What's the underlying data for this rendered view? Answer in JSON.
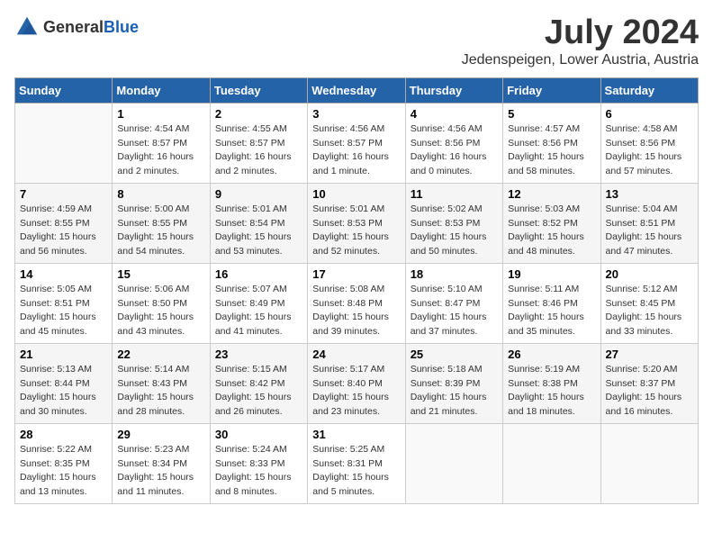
{
  "header": {
    "logo_general": "General",
    "logo_blue": "Blue",
    "month": "July 2024",
    "location": "Jedenspeigen, Lower Austria, Austria"
  },
  "weekdays": [
    "Sunday",
    "Monday",
    "Tuesday",
    "Wednesday",
    "Thursday",
    "Friday",
    "Saturday"
  ],
  "weeks": [
    [
      {
        "day": "",
        "info": ""
      },
      {
        "day": "1",
        "info": "Sunrise: 4:54 AM\nSunset: 8:57 PM\nDaylight: 16 hours\nand 2 minutes."
      },
      {
        "day": "2",
        "info": "Sunrise: 4:55 AM\nSunset: 8:57 PM\nDaylight: 16 hours\nand 2 minutes."
      },
      {
        "day": "3",
        "info": "Sunrise: 4:56 AM\nSunset: 8:57 PM\nDaylight: 16 hours\nand 1 minute."
      },
      {
        "day": "4",
        "info": "Sunrise: 4:56 AM\nSunset: 8:56 PM\nDaylight: 16 hours\nand 0 minutes."
      },
      {
        "day": "5",
        "info": "Sunrise: 4:57 AM\nSunset: 8:56 PM\nDaylight: 15 hours\nand 58 minutes."
      },
      {
        "day": "6",
        "info": "Sunrise: 4:58 AM\nSunset: 8:56 PM\nDaylight: 15 hours\nand 57 minutes."
      }
    ],
    [
      {
        "day": "7",
        "info": "Sunrise: 4:59 AM\nSunset: 8:55 PM\nDaylight: 15 hours\nand 56 minutes."
      },
      {
        "day": "8",
        "info": "Sunrise: 5:00 AM\nSunset: 8:55 PM\nDaylight: 15 hours\nand 54 minutes."
      },
      {
        "day": "9",
        "info": "Sunrise: 5:01 AM\nSunset: 8:54 PM\nDaylight: 15 hours\nand 53 minutes."
      },
      {
        "day": "10",
        "info": "Sunrise: 5:01 AM\nSunset: 8:53 PM\nDaylight: 15 hours\nand 52 minutes."
      },
      {
        "day": "11",
        "info": "Sunrise: 5:02 AM\nSunset: 8:53 PM\nDaylight: 15 hours\nand 50 minutes."
      },
      {
        "day": "12",
        "info": "Sunrise: 5:03 AM\nSunset: 8:52 PM\nDaylight: 15 hours\nand 48 minutes."
      },
      {
        "day": "13",
        "info": "Sunrise: 5:04 AM\nSunset: 8:51 PM\nDaylight: 15 hours\nand 47 minutes."
      }
    ],
    [
      {
        "day": "14",
        "info": "Sunrise: 5:05 AM\nSunset: 8:51 PM\nDaylight: 15 hours\nand 45 minutes."
      },
      {
        "day": "15",
        "info": "Sunrise: 5:06 AM\nSunset: 8:50 PM\nDaylight: 15 hours\nand 43 minutes."
      },
      {
        "day": "16",
        "info": "Sunrise: 5:07 AM\nSunset: 8:49 PM\nDaylight: 15 hours\nand 41 minutes."
      },
      {
        "day": "17",
        "info": "Sunrise: 5:08 AM\nSunset: 8:48 PM\nDaylight: 15 hours\nand 39 minutes."
      },
      {
        "day": "18",
        "info": "Sunrise: 5:10 AM\nSunset: 8:47 PM\nDaylight: 15 hours\nand 37 minutes."
      },
      {
        "day": "19",
        "info": "Sunrise: 5:11 AM\nSunset: 8:46 PM\nDaylight: 15 hours\nand 35 minutes."
      },
      {
        "day": "20",
        "info": "Sunrise: 5:12 AM\nSunset: 8:45 PM\nDaylight: 15 hours\nand 33 minutes."
      }
    ],
    [
      {
        "day": "21",
        "info": "Sunrise: 5:13 AM\nSunset: 8:44 PM\nDaylight: 15 hours\nand 30 minutes."
      },
      {
        "day": "22",
        "info": "Sunrise: 5:14 AM\nSunset: 8:43 PM\nDaylight: 15 hours\nand 28 minutes."
      },
      {
        "day": "23",
        "info": "Sunrise: 5:15 AM\nSunset: 8:42 PM\nDaylight: 15 hours\nand 26 minutes."
      },
      {
        "day": "24",
        "info": "Sunrise: 5:17 AM\nSunset: 8:40 PM\nDaylight: 15 hours\nand 23 minutes."
      },
      {
        "day": "25",
        "info": "Sunrise: 5:18 AM\nSunset: 8:39 PM\nDaylight: 15 hours\nand 21 minutes."
      },
      {
        "day": "26",
        "info": "Sunrise: 5:19 AM\nSunset: 8:38 PM\nDaylight: 15 hours\nand 18 minutes."
      },
      {
        "day": "27",
        "info": "Sunrise: 5:20 AM\nSunset: 8:37 PM\nDaylight: 15 hours\nand 16 minutes."
      }
    ],
    [
      {
        "day": "28",
        "info": "Sunrise: 5:22 AM\nSunset: 8:35 PM\nDaylight: 15 hours\nand 13 minutes."
      },
      {
        "day": "29",
        "info": "Sunrise: 5:23 AM\nSunset: 8:34 PM\nDaylight: 15 hours\nand 11 minutes."
      },
      {
        "day": "30",
        "info": "Sunrise: 5:24 AM\nSunset: 8:33 PM\nDaylight: 15 hours\nand 8 minutes."
      },
      {
        "day": "31",
        "info": "Sunrise: 5:25 AM\nSunset: 8:31 PM\nDaylight: 15 hours\nand 5 minutes."
      },
      {
        "day": "",
        "info": ""
      },
      {
        "day": "",
        "info": ""
      },
      {
        "day": "",
        "info": ""
      }
    ]
  ]
}
